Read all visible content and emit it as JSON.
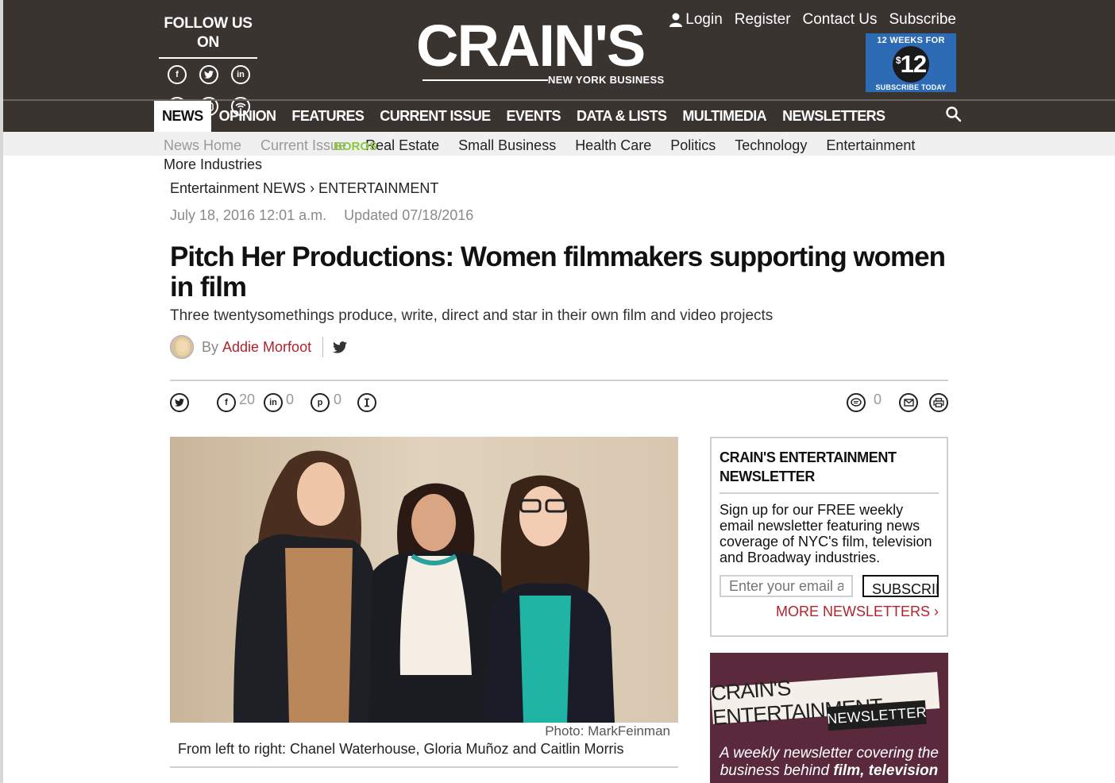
{
  "header": {
    "follow_title": "FOLLOW US ON",
    "social_icons": [
      "facebook-icon",
      "twitter-icon",
      "linkedin-icon",
      "pinterest-icon",
      "instagram-icon",
      "rss-icon"
    ],
    "logo_main": "CRAIN'S",
    "logo_sub": "NEW YORK BUSINESS",
    "account": {
      "login": "Login",
      "register": "Register",
      "contact": "Contact Us",
      "subscribe": "Subscribe"
    },
    "promo": {
      "top": "12 WEEKS FOR",
      "currency": "$",
      "price": "12",
      "bottom": "SUBSCRIBE TODAY",
      "color": "#2d6bb5"
    }
  },
  "nav": {
    "items": [
      "NEWS",
      "OPINION",
      "FEATURES",
      "CURRENT ISSUE",
      "EVENTS",
      "DATA & LISTS",
      "MULTIMEDIA",
      "NEWSLETTERS"
    ],
    "active": "NEWS"
  },
  "subnav": {
    "items": [
      "News Home",
      "Current Issue",
      "Real Estate",
      "Small Business",
      "Health Care",
      "Politics",
      "Technology",
      "Entertainment"
    ],
    "boros": "BOROS",
    "more": "More Industries"
  },
  "article": {
    "breadcrumb": "Entertainment NEWS › ENTERTAINMENT",
    "date": "July 18, 2016 12:01 a.m.",
    "updated": "Updated 07/18/2016",
    "headline": "Pitch Her Productions: Women filmmakers supporting women in film",
    "dek": "Three twentysomethings produce, write, direct and star in their own film and video projects",
    "by": "By",
    "author": "Addie Morfoot",
    "share": {
      "facebook_count": "20",
      "linkedin_count": "0",
      "pinterest_count": "0",
      "comments_count": "0"
    },
    "photo_credit": "Photo: MarkFeinman",
    "caption": "From left to right: Chanel Waterhouse, Gloria Muñoz and Caitlin Morris"
  },
  "sidebar": {
    "newsletter_title": "CRAIN'S ENTERTAINMENT NEWSLETTER",
    "newsletter_text": "Sign up for our FREE weekly email newsletter featuring news coverage of NYC's film, television and Broadway industries.",
    "email_placeholder": "Enter your email address",
    "subscribe_button": "SUBSCRIBE",
    "more_newsletters": "MORE NEWSLETTERS ›",
    "promo_banner": "CRAIN'S ENTERTAINMENT",
    "promo_tag": "NEWSLETTER",
    "promo_text_1": "A weekly newsletter covering the",
    "promo_text_2": "business behind",
    "promo_text_bold": "film, television"
  },
  "colors": {
    "header_bg": "#3a3431",
    "accent_red": "#b3232b",
    "boros_green": "#8dc63f",
    "promo_maroon": "#5a2a3c"
  }
}
